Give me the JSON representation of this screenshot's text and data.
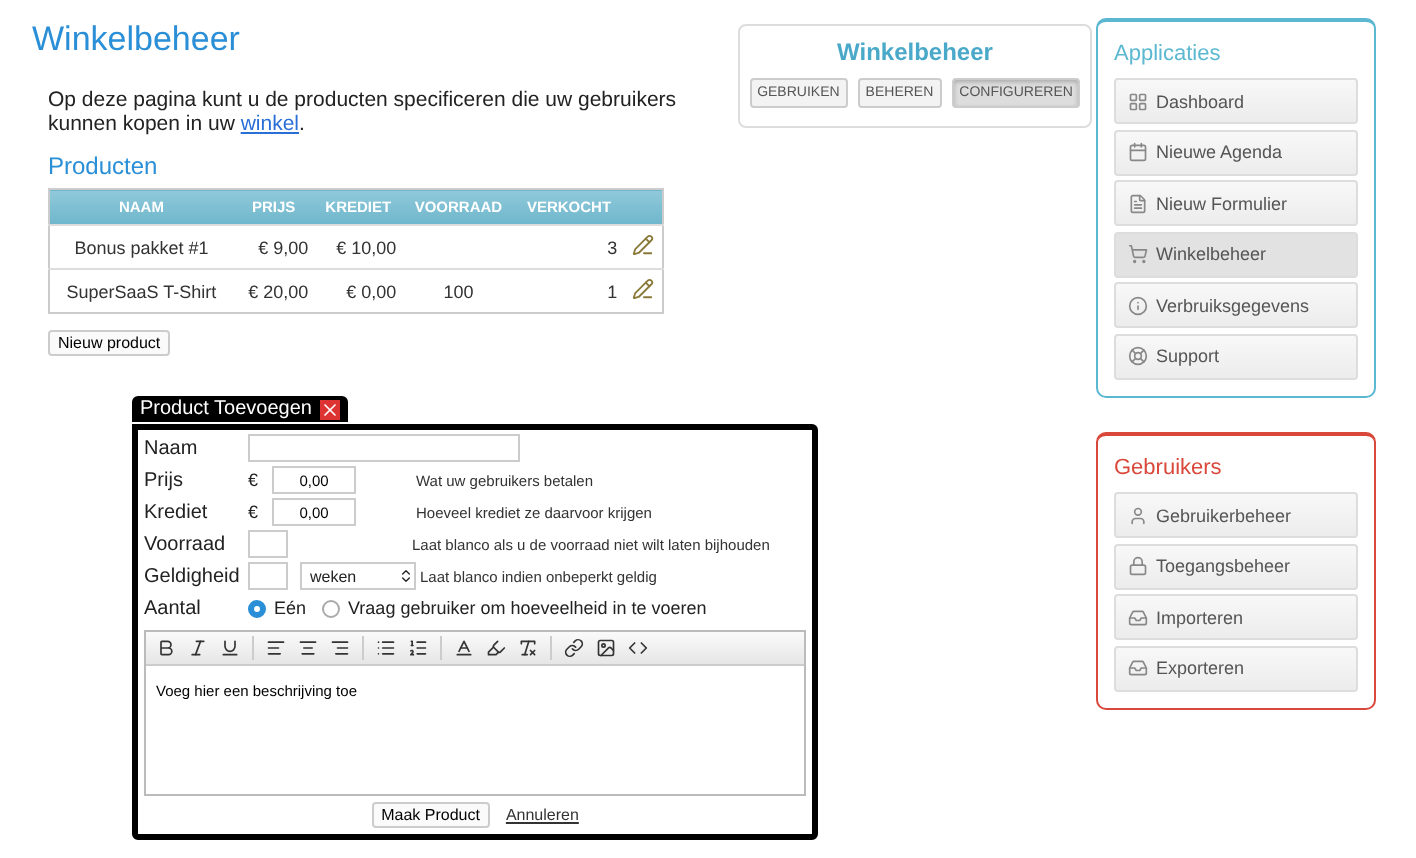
{
  "page": {
    "title": "Winkelbeheer",
    "intro_before": "Op deze pagina kunt u de producten specificeren die uw gebruikers kunnen kopen in uw ",
    "intro_link": "winkel",
    "intro_after": "."
  },
  "section_title": "Producten",
  "table": {
    "columns": [
      "NAAM",
      "PRIJS",
      "KREDIET",
      "VOORRAAD",
      "VERKOCHT"
    ],
    "rows": [
      {
        "cells": [
          "Bonus pakket #1",
          "€ 9,00",
          "€ 10,00",
          "",
          "3"
        ]
      },
      {
        "cells": [
          "SuperSaaS T-Shirt",
          "€ 20,00",
          "€ 0,00",
          "100",
          "1"
        ]
      }
    ]
  },
  "new_button": "Nieuw product",
  "mode_panel": {
    "title": "Winkelbeheer",
    "tabs": [
      {
        "label": "GEBRUIKEN",
        "selected": false
      },
      {
        "label": "BEHEREN",
        "selected": false
      },
      {
        "label": "CONFIGUREREN",
        "selected": true
      }
    ]
  },
  "dialog": {
    "title": "Product Toevoegen",
    "fields": [
      {
        "kind": "text",
        "label": "Naam"
      },
      {
        "kind": "money",
        "label": "Prijs",
        "currency": "€",
        "value": "0,00",
        "hint": "Wat uw gebruikers betalen"
      },
      {
        "kind": "money",
        "label": "Krediet",
        "currency": "€",
        "value": "0,00",
        "hint": "Hoeveel krediet ze daarvoor krijgen"
      },
      {
        "kind": "number",
        "label": "Voorraad",
        "hint": "Laat blanco als u de voorraad niet wilt laten bijhouden"
      },
      {
        "kind": "duration",
        "label": "Geldigheid",
        "unit": "weken",
        "hint": "Laat blanco indien onbeperkt geldig"
      },
      {
        "kind": "radio",
        "label": "Aantal",
        "options": [
          {
            "label": "Eén",
            "selected": true
          },
          {
            "label": "Vraag gebruiker om hoeveelheid in te voeren",
            "selected": false
          }
        ]
      }
    ],
    "editor_text": "Voeg hier een beschrijving toe",
    "submit": "Maak Product",
    "cancel": "Annuleren"
  },
  "sidebar": [
    {
      "title": "Applicaties",
      "color": "#5bb8d0",
      "items": [
        {
          "label": "Dashboard",
          "selected": false
        },
        {
          "label": "Nieuwe Agenda",
          "selected": false
        },
        {
          "label": "Nieuw Formulier",
          "selected": false
        },
        {
          "label": "Winkelbeheer",
          "selected": true
        },
        {
          "label": "Verbruiksgegevens",
          "selected": false
        },
        {
          "label": "Support",
          "selected": false
        }
      ]
    },
    {
      "title": "Gebruikers",
      "color": "#d9483b",
      "items": [
        {
          "label": "Gebruikerbeheer",
          "selected": false
        },
        {
          "label": "Toegangsbeheer",
          "selected": false
        },
        {
          "label": "Importeren",
          "selected": false
        },
        {
          "label": "Exporteren",
          "selected": false
        }
      ]
    }
  ]
}
